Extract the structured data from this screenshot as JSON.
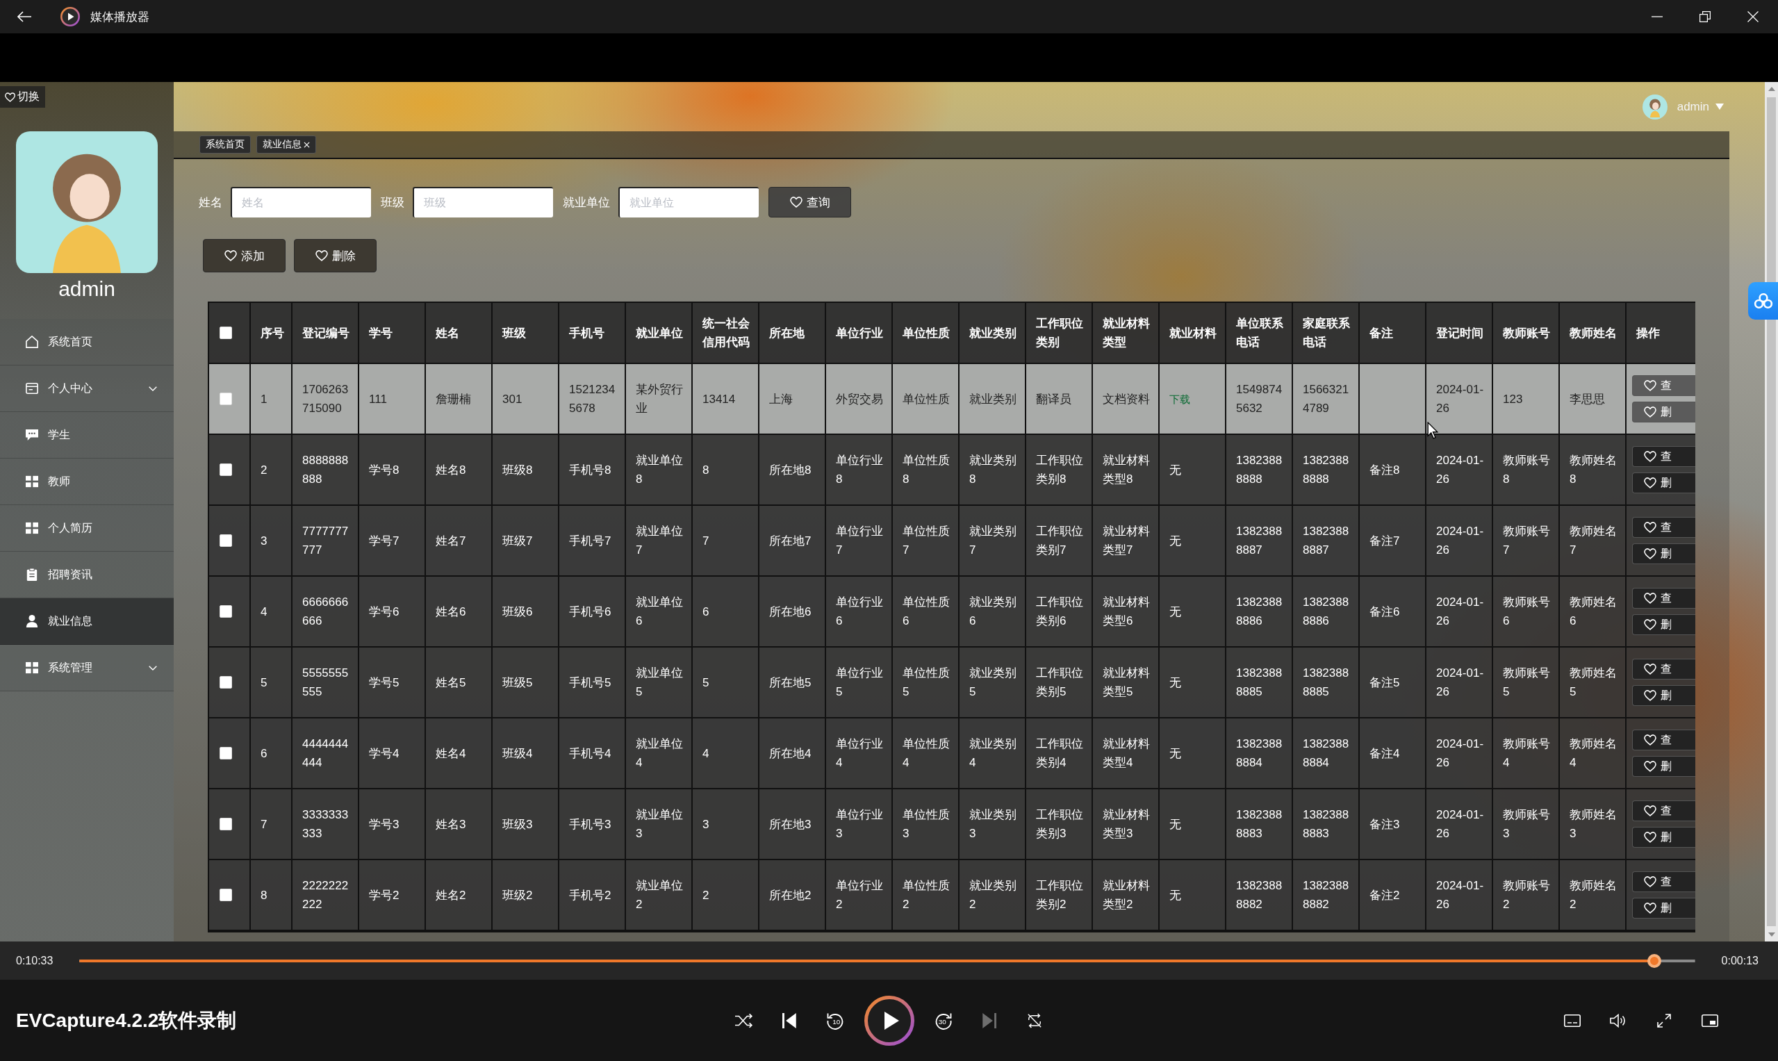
{
  "window": {
    "title": "媒体播放器"
  },
  "app": {
    "switch_button": "切换",
    "sidebar": {
      "user_name": "admin",
      "items": [
        {
          "label": "系统首页",
          "kind": "link",
          "selected": false
        },
        {
          "label": "个人中心",
          "kind": "group",
          "selected": false
        },
        {
          "label": "学生",
          "kind": "link",
          "selected": false
        },
        {
          "label": "教师",
          "kind": "link",
          "selected": false
        },
        {
          "label": "个人简历",
          "kind": "link",
          "selected": false
        },
        {
          "label": "招聘资讯",
          "kind": "link",
          "selected": false
        },
        {
          "label": "就业信息",
          "kind": "link",
          "selected": true
        },
        {
          "label": "系统管理",
          "kind": "group",
          "selected": false
        }
      ]
    },
    "header": {
      "user_name": "admin"
    },
    "tabs": [
      {
        "label": "系统首页",
        "closable": false
      },
      {
        "label": "就业信息",
        "closable": true
      }
    ],
    "search": {
      "fields": [
        {
          "label": "姓名",
          "placeholder": "姓名"
        },
        {
          "label": "班级",
          "placeholder": "班级"
        },
        {
          "label": "就业单位",
          "placeholder": "就业单位"
        }
      ],
      "button": "查询"
    },
    "actions": [
      "添加",
      "删除"
    ],
    "table": {
      "select_all": {
        "checked": false
      },
      "columns": [
        "序号",
        "登记编号",
        "学号",
        "姓名",
        "班级",
        "手机号",
        "就业单位",
        "统一社会信用代码",
        "所在地",
        "单位行业",
        "单位性质",
        "就业类别",
        "工作职位类别",
        "就业材料类型",
        "就业材料",
        "单位联系电话",
        "家庭联系电话",
        "备注",
        "登记时间",
        "教师账号",
        "教师姓名",
        "操作"
      ],
      "rows": [
        {
          "highlighted": true,
          "checked": false,
          "cells": [
            "1",
            "1706263715090",
            "111",
            "詹珊楠",
            "301",
            "15212345678",
            "某外贸行业",
            "13414",
            "上海",
            "外贸交易",
            "单位性质",
            "就业类别",
            "翻译员",
            "文档资料",
            {
              "text": "下载",
              "kind": "link"
            },
            "15498745632",
            "15663214789",
            null,
            "2024-01-26",
            "123",
            "李思思"
          ],
          "actions": [
            "查",
            "删"
          ]
        },
        {
          "highlighted": false,
          "checked": false,
          "cells": [
            "2",
            "8888888888",
            "学号8",
            "姓名8",
            "班级8",
            "手机号8",
            "就业单位8",
            "8",
            "所在地8",
            "单位行业8",
            "单位性质8",
            "就业类别8",
            "工作职位类别8",
            "就业材料类型8",
            {
              "text": "无",
              "kind": "text"
            },
            "13823888888",
            "13823888888",
            "备注8",
            "2024-01-26",
            "教师账号8",
            "教师姓名8"
          ],
          "actions": [
            "查",
            "删"
          ]
        },
        {
          "highlighted": false,
          "checked": false,
          "cells": [
            "3",
            "7777777777",
            "学号7",
            "姓名7",
            "班级7",
            "手机号7",
            "就业单位7",
            "7",
            "所在地7",
            "单位行业7",
            "单位性质7",
            "就业类别7",
            "工作职位类别7",
            "就业材料类型7",
            {
              "text": "无",
              "kind": "text"
            },
            "13823888887",
            "13823888887",
            "备注7",
            "2024-01-26",
            "教师账号7",
            "教师姓名7"
          ],
          "actions": [
            "查",
            "删"
          ]
        },
        {
          "highlighted": false,
          "checked": false,
          "cells": [
            "4",
            "6666666666",
            "学号6",
            "姓名6",
            "班级6",
            "手机号6",
            "就业单位6",
            "6",
            "所在地6",
            "单位行业6",
            "单位性质6",
            "就业类别6",
            "工作职位类别6",
            "就业材料类型6",
            {
              "text": "无",
              "kind": "text"
            },
            "13823888886",
            "13823888886",
            "备注6",
            "2024-01-26",
            "教师账号6",
            "教师姓名6"
          ],
          "actions": [
            "查",
            "删"
          ]
        },
        {
          "highlighted": false,
          "checked": false,
          "cells": [
            "5",
            "5555555555",
            "学号5",
            "姓名5",
            "班级5",
            "手机号5",
            "就业单位5",
            "5",
            "所在地5",
            "单位行业5",
            "单位性质5",
            "就业类别5",
            "工作职位类别5",
            "就业材料类型5",
            {
              "text": "无",
              "kind": "text"
            },
            "13823888885",
            "13823888885",
            "备注5",
            "2024-01-26",
            "教师账号5",
            "教师姓名5"
          ],
          "actions": [
            "查",
            "删"
          ]
        },
        {
          "highlighted": false,
          "checked": false,
          "cells": [
            "6",
            "4444444444",
            "学号4",
            "姓名4",
            "班级4",
            "手机号4",
            "就业单位4",
            "4",
            "所在地4",
            "单位行业4",
            "单位性质4",
            "就业类别4",
            "工作职位类别4",
            "就业材料类型4",
            {
              "text": "无",
              "kind": "text"
            },
            "13823888884",
            "13823888884",
            "备注4",
            "2024-01-26",
            "教师账号4",
            "教师姓名4"
          ],
          "actions": [
            "查",
            "删"
          ]
        },
        {
          "highlighted": false,
          "checked": false,
          "cells": [
            "7",
            "3333333333",
            "学号3",
            "姓名3",
            "班级3",
            "手机号3",
            "就业单位3",
            "3",
            "所在地3",
            "单位行业3",
            "单位性质3",
            "就业类别3",
            "工作职位类别3",
            "就业材料类型3",
            {
              "text": "无",
              "kind": "text"
            },
            "13823888883",
            "13823888883",
            "备注3",
            "2024-01-26",
            "教师账号3",
            "教师姓名3"
          ],
          "actions": [
            "查",
            "删"
          ]
        },
        {
          "highlighted": false,
          "checked": false,
          "cells": [
            "8",
            "2222222222",
            "学号2",
            "姓名2",
            "班级2",
            "手机号2",
            "就业单位2",
            "2",
            "所在地2",
            "单位行业2",
            "单位性质2",
            "就业类别2",
            "工作职位类别2",
            "就业材料类型2",
            {
              "text": "无",
              "kind": "text"
            },
            "13823888882",
            "13823888882",
            "备注2",
            "2024-01-26",
            "教师账号2",
            "教师姓名2"
          ],
          "actions": [
            "查",
            "删"
          ]
        }
      ]
    }
  },
  "player": {
    "elapsed": "0:10:33",
    "level": 0.975,
    "remaining": "0:00:13",
    "video_title": "EVCapture4.2.2软件录制",
    "skip_back": "10",
    "skip_forward": "30",
    "playing": false,
    "next_disabled": true
  }
}
